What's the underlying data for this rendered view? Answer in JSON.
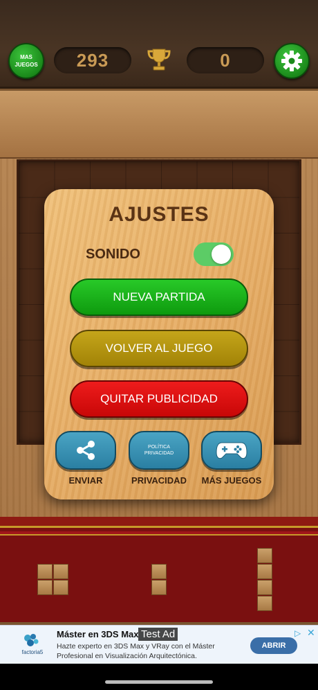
{
  "header": {
    "more_games_line1": "MAS",
    "more_games_line2": "JUEGOS",
    "score": "293",
    "best": "0"
  },
  "dialog": {
    "title": "AJUSTES",
    "sound_label": "SONIDO",
    "sound_on": true,
    "new_game": "NUEVA PARTIDA",
    "back_to_game": "VOLVER AL JUEGO",
    "remove_ads": "QUITAR PUBLICIDAD",
    "privacy_icon_line1": "POLÍTICA",
    "privacy_icon_line2": "PRIVACIDAD",
    "share_label": "ENVIAR",
    "privacy_label": "PRIVACIDAD",
    "more_games_label": "MÁS JUEGOS"
  },
  "ad": {
    "tag": "Test Ad",
    "title": "Máster en 3DS Max",
    "description": "Hazte experto en 3DS Max y VRay con el Máster Profesional en Visualización Arquitectónica.",
    "cta": "ABRIR",
    "brand": "factoria5"
  },
  "colors": {
    "green": "#1b9a1b",
    "gold": "#b3940f",
    "red": "#d90f0f",
    "blue": "#3a92b4",
    "toggle": "#5ccc66"
  }
}
